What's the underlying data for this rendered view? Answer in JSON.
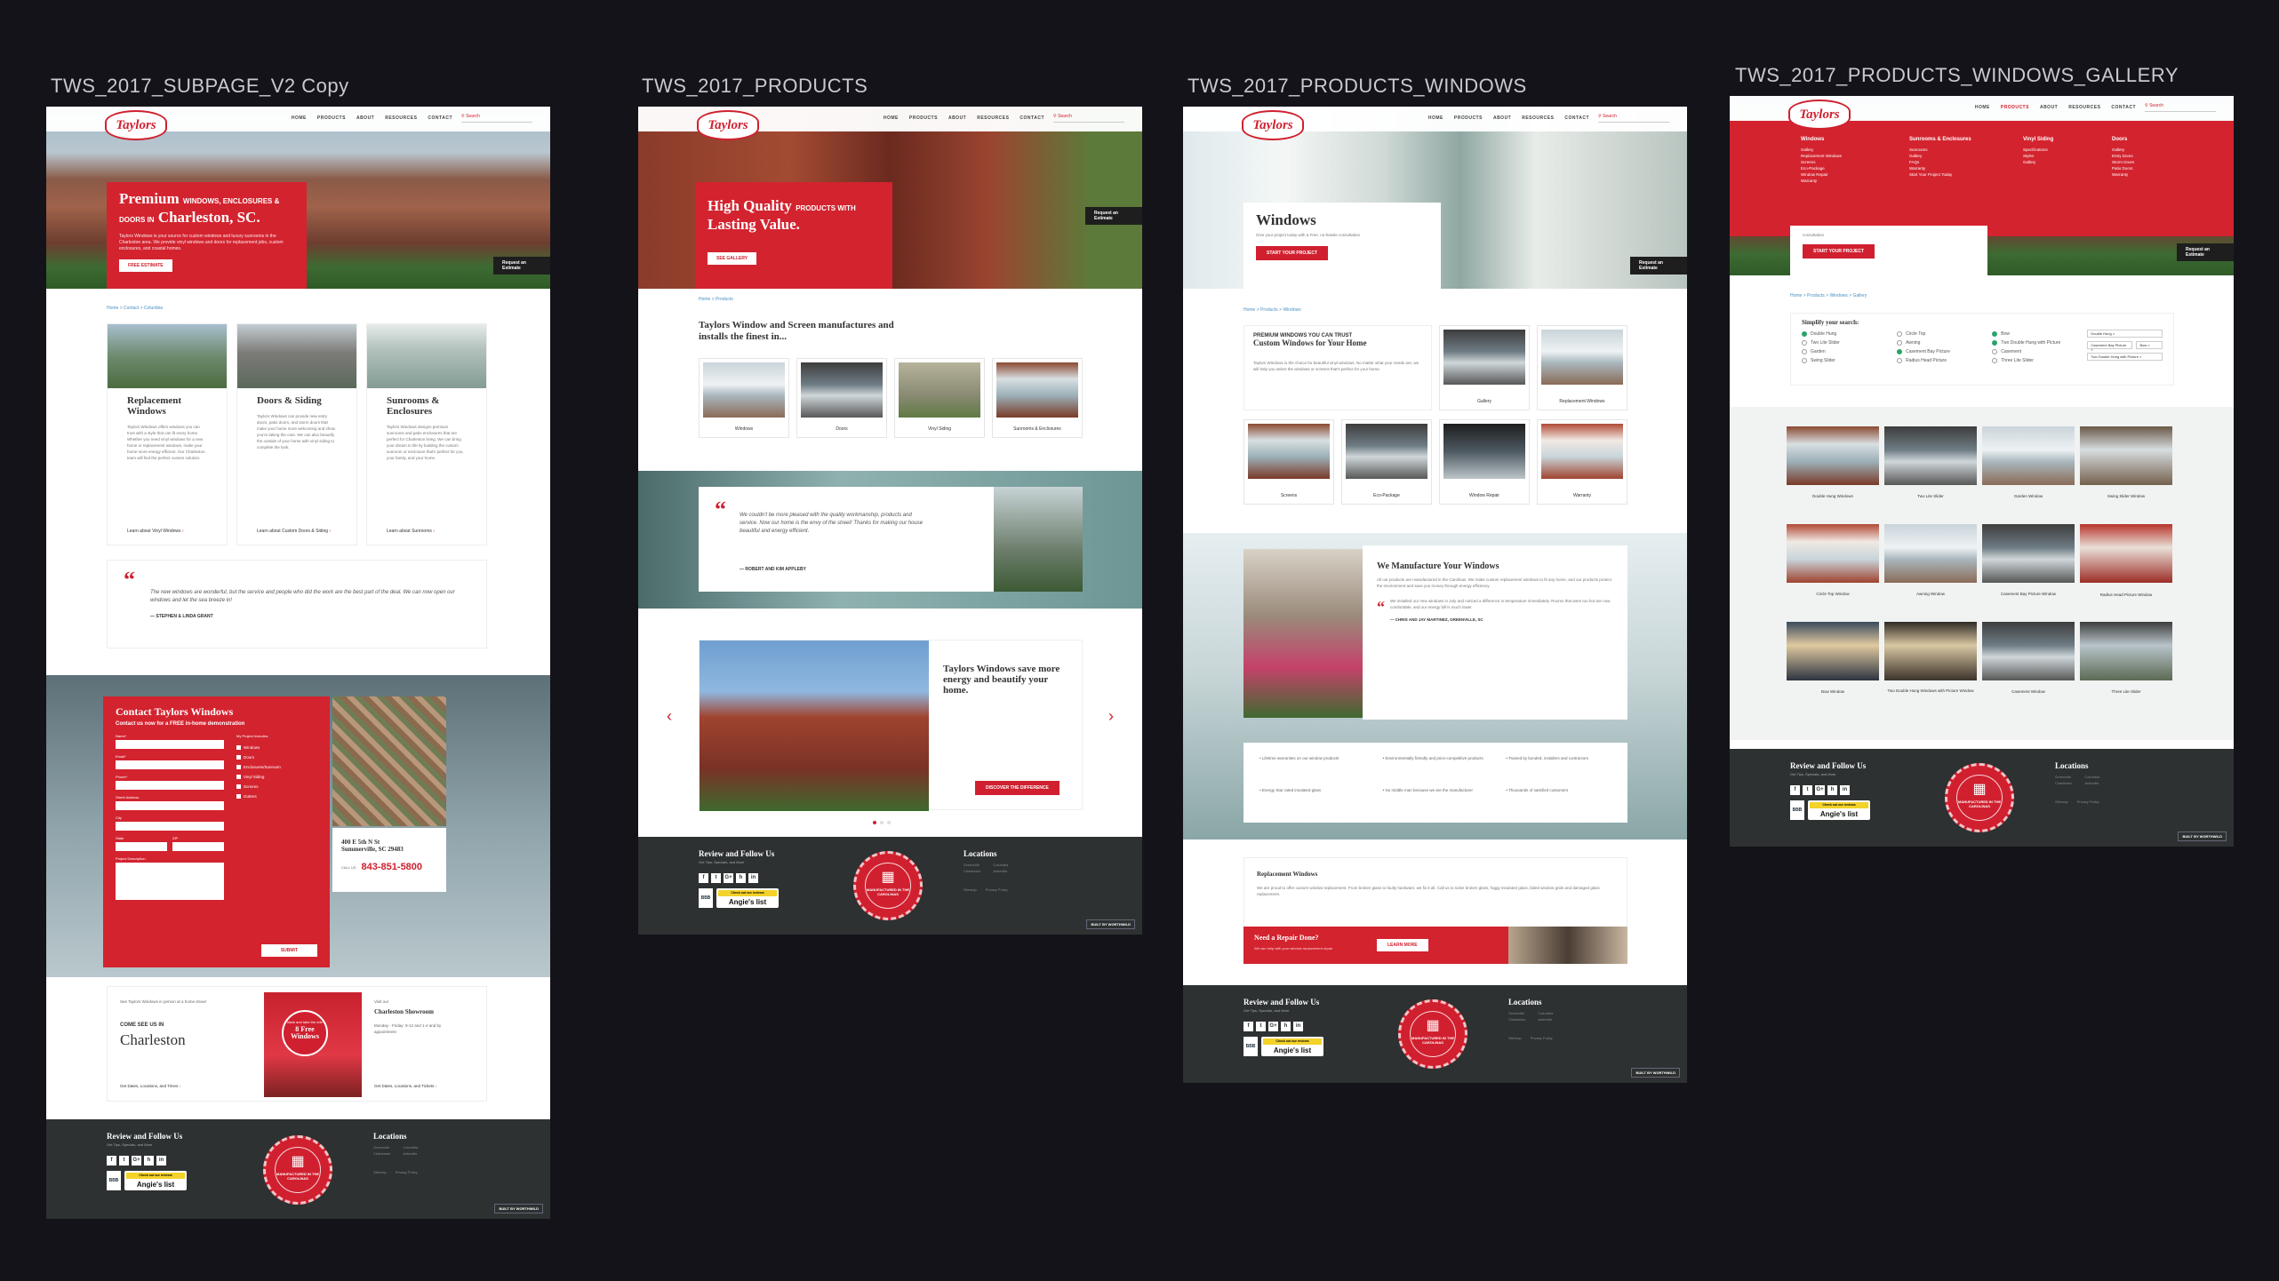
{
  "labels": {
    "a1": "TWS_2017_SUBPAGE_V2 Copy",
    "a2": "TWS_2017_PRODUCTS",
    "a3": "TWS_2017_PRODUCTS_WINDOWS",
    "a4": "TWS_2017_PRODUCTS_WINDOWS_GALLERY"
  },
  "brand": {
    "logo": "Taylors",
    "accent": "#d0202f",
    "footer_bg": "#2d3131"
  },
  "nav": [
    "HOME",
    "PRODUCTS",
    "ABOUT",
    "RESOURCES",
    "CONTACT"
  ],
  "search_placeholder": "Search",
  "request_estimate": "Request an Estimate",
  "subpage": {
    "hero_title_1": "Premium",
    "hero_title_small": "WINDOWS, ENCLOSURES & DOORS IN",
    "hero_title_2": "Charleston, SC.",
    "hero_text": "Taylors Windows is your source for custom windows and luxury sunrooms in the Charleston area. We provide vinyl windows and doors for replacement jobs, custom enclosures, and coastal homes.",
    "hero_btn": "FREE ESTIMATE",
    "crumbs": "Home  >  Contact  >  Columbia",
    "cards": [
      {
        "title": "Replacement Windows",
        "body": "Taylors Windows offers windows you can trust with a style that can fit every home. Whether you need vinyl windows for a new home or replacement windows, make your home more energy efficient. Our Charleston team will find the perfect custom solution.",
        "link": "Learn about Vinyl Windows"
      },
      {
        "title": "Doors & Siding",
        "body": "Taylors Windows can provide new entry doors, patio doors, and storm doors that make your home more welcoming and show you're taking the care. We can also beautify the outside of your home with vinyl siding to complete the look.",
        "link": "Learn about Custom Doors & Siding"
      },
      {
        "title": "Sunrooms & Enclosures",
        "body": "Taylors Windows designs premium sunrooms and patio enclosures that are perfect for Charleston living. We can bring your dream to life by building the custom sunroom or enclosure that's perfect for you, your family, and your home.",
        "link": "Learn about Sunrooms"
      }
    ],
    "quote": "The new windows are wonderful, but the service and people who did the work are the best part of the deal. We can now open our windows and let the sea breeze in!",
    "quote_by": "— STEPHEN & LINDA GRANT",
    "contact_title": "Contact Taylors Windows",
    "contact_sub": "Contact us now for a FREE in-home demonstration",
    "fields": [
      "Name*",
      "Email*",
      "Phone*",
      "Street Address",
      "City",
      "State",
      "ZIP",
      "Project Description"
    ],
    "project_includes": "My Project Includes:",
    "options": [
      "Windows",
      "Doors",
      "Enclosures/Sunroom",
      "Vinyl Siding",
      "Screens",
      "Gutters"
    ],
    "submit": "SUBMIT",
    "address_1": "400 E 5th N St",
    "address_2": "Summerville, SC 29483",
    "call_label": "CALL US",
    "phone": "843-851-5800",
    "showroom_kicker": "See Taylors Windows in person at a home show!",
    "showroom_come": "COME SEE US IN",
    "showroom_city": "Charleston",
    "showroom_link": "Get Dates, Locations, and Times",
    "promo_line_1": "Visit our",
    "promo_line_2": "Charleston Showroom",
    "promo_big": "8 Free Windows",
    "promo_small": "Mark and take the ride",
    "showroom_hours": "Monday - Friday: 9-12 and 1-4 and by appointment",
    "showroom_title": "Charleston Showroom",
    "visit": "Visit our",
    "showroom_link2": "Get Dates, Locations, and Tickets"
  },
  "products": {
    "hero_title_1": "High Quality",
    "hero_small": "PRODUCTS WITH",
    "hero_title_2": "Lasting Value.",
    "hero_btn": "SEE GALLERY",
    "crumbs": "Home  >  Products",
    "intro": "Taylors Window and Screen manufactures and installs the finest in...",
    "tiles": [
      "Windows",
      "Doors",
      "Vinyl Siding",
      "Sunrooms & Enclosures"
    ],
    "quote": "We couldn't be more pleased with the quality workmanship, products and service. Now our home is the envy of the street! Thanks for making our house beautiful and energy efficient.",
    "quote_by": "— ROBERT AND KIM APPLEBY",
    "slide_title": "Taylors Windows save more energy and beautify your home.",
    "slide_btn": "DISCOVER THE DIFFERENCE"
  },
  "windows": {
    "hero_title": "Windows",
    "hero_sub": "Give your project today with a Free, no-hassle consultation",
    "hero_btn": "START YOUR PROJECT",
    "crumbs": "Home  >  Products  >  Windows",
    "trust_kicker": "PREMIUM WINDOWS YOU CAN TRUST",
    "trust_title": "Custom Windows for Your Home",
    "trust_body": "Taylors Windows is the choice for beautiful vinyl windows. No matter what your needs are, we will help you select the windows or screens that's perfect for your home.",
    "tiles_top": [
      "Gallery",
      "Replacement Windows"
    ],
    "tiles_bottom": [
      "Screens",
      "Eco-Package",
      "Window Repair",
      "Warranty"
    ],
    "manufacture_title": "We Manufacture Your Windows",
    "manufacture_body": "All our products are manufactured in the Carolinas. We make custom replacement windows to fit any home, and our products protect the environment and save you money through energy efficiency.",
    "manufacture_quote": "We installed our new windows in July and noticed a difference in temperature immediately. Rooms that were too hot are now comfortable, and our energy bill is much lower.",
    "manufacture_by": "— CHRIS AND JAY MARTINEZ, GREENVILLE, SC",
    "benefits": [
      "Lifetime warranties on our window products",
      "Environmentally friendly and price-competitive products",
      "Trained by bonded, installers and contractors",
      "Energy Star rated insulated glass",
      "No middle man because we are the manufacturer",
      "Thousands of satisfied customers"
    ],
    "replacement_title": "Replacement Windows",
    "replacement_body": "We are proud to offer custom window replacement. From broken glass to faulty hardware, we fix it all. Call us to solve broken glass, foggy insulated glass, failed window grids and damaged glass replacement.",
    "repair_title": "Need a Repair Done?",
    "repair_sub": "We can help with your window replacement repair",
    "repair_btn": "LEARN MORE"
  },
  "gallery": {
    "menu_cols": [
      {
        "head": "Windows",
        "items": [
          "Gallery",
          "Replacement Windows",
          "Screens",
          "Eco-Package",
          "Window Repair",
          "Warranty"
        ]
      },
      {
        "head": "Sunrooms & Enclosures",
        "items": [
          "Sunrooms",
          "Gallery",
          "FAQs",
          "Warranty",
          "Start Your Project Today"
        ]
      },
      {
        "head": "Vinyl Siding",
        "items": [
          "Specifications",
          "Styles",
          "Gallery"
        ]
      },
      {
        "head": "Doors",
        "items": [
          "Gallery",
          "Entry Doors",
          "Storm Doors",
          "Patio Doors",
          "Warranty"
        ]
      }
    ],
    "consult_label": "consultation",
    "hero_btn": "START YOUR PROJECT",
    "crumbs": "Home  >  Products  >  Windows  >  Gallery",
    "filter_title": "Simplify your search:",
    "filter_col1": [
      "Double Hung",
      "Two Lite Slider",
      "Garden",
      "Swing Slider"
    ],
    "filter_col2": [
      "Circle Top",
      "Awning",
      "Casement Bay Picture",
      "Radius Head Picture"
    ],
    "filter_col3": [
      "Bow",
      "Two Double Hung with Picture",
      "Casement",
      "Three Lite Slider"
    ],
    "filter_selects": [
      "Double Hung",
      "Casement Bay Picture",
      "Bow",
      "Two Double Hung with Picture"
    ],
    "items": [
      "Double Hung Windows",
      "Two Lite Slider",
      "Garden Window",
      "Swing Slider Window",
      "Circle Top Window",
      "Awning Window",
      "Casement Bay Picture Window",
      "Radius Head Picture Window",
      "Bow Window",
      "Two Double Hung Windows with Picture Window",
      "Casement Window",
      "Three Lite Slider"
    ]
  },
  "footer": {
    "title": "Review and Follow Us",
    "sub": "Get Tips, Specials, and More",
    "social": [
      "f",
      "t",
      "G+",
      "h",
      "in"
    ],
    "bbb": "BBB",
    "angies_top": "Check out our reviews",
    "angies_main": "Angie's list",
    "seal_top": "TAYLORS WINDOW & SCREEN",
    "seal_text": "MANUFACTURED IN THE CAROLINAS",
    "locations_title": "Locations",
    "locations": [
      "Greenville",
      "Columbia",
      "Charleston",
      "Asheville"
    ],
    "legal": [
      "Sitemap",
      "Privacy Policy"
    ],
    "built_by": "BUILT BY WORTHWILD"
  }
}
